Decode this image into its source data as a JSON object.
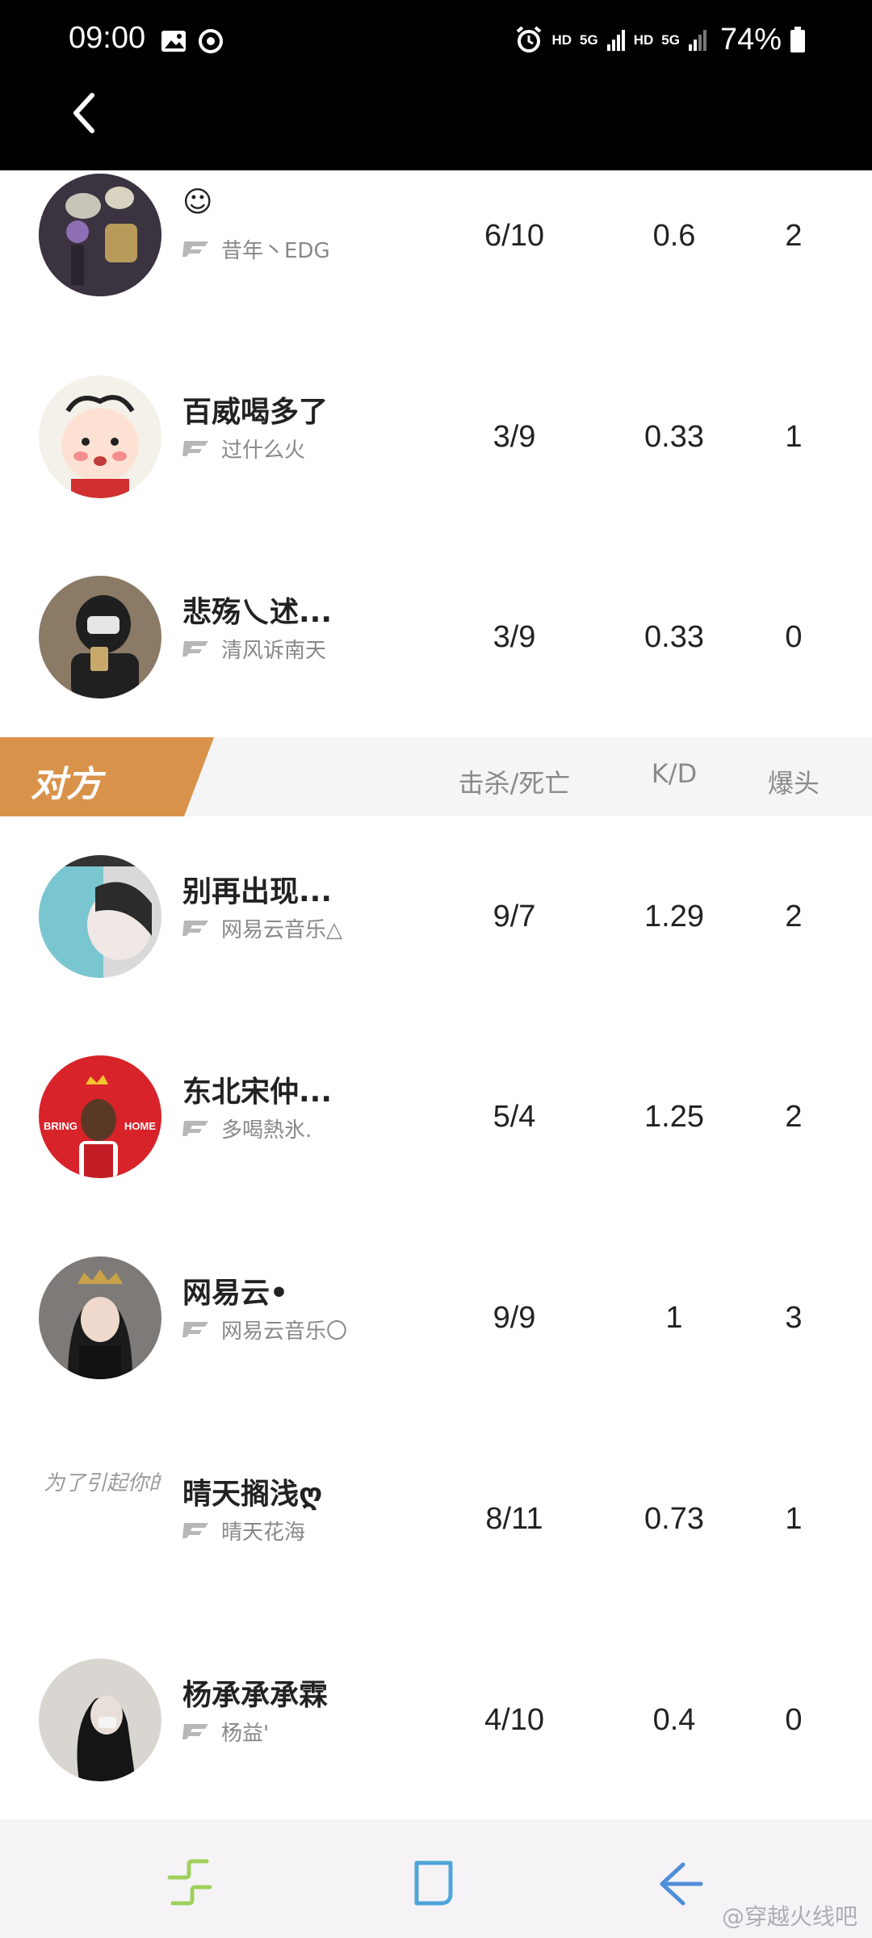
{
  "status_bar": {
    "time": "09:00",
    "hd1": "HD",
    "net1": "5G",
    "hd2": "HD",
    "net2": "5G",
    "battery": "74%"
  },
  "section_opponent": {
    "label": "对方",
    "col_kd": "击杀/死亡",
    "col_ratio": "K/D",
    "col_hs": "爆头",
    "accent_color": "#d9924a"
  },
  "team_players": [
    {
      "name": "☺",
      "sub": "昔年丶EDG",
      "kd": "6/10",
      "ratio": "0.6",
      "hs": "2"
    },
    {
      "name": "百威喝多了",
      "sub": "过什么火",
      "kd": "3/9",
      "ratio": "0.33",
      "hs": "1"
    },
    {
      "name": "悲殇乀述...",
      "sub": "清风诉南天",
      "kd": "3/9",
      "ratio": "0.33",
      "hs": "0"
    }
  ],
  "opponent_players": [
    {
      "name": "别再出现...",
      "sub": "网易云音乐△",
      "kd": "9/7",
      "ratio": "1.29",
      "hs": "2"
    },
    {
      "name": "东北宋仲...",
      "sub": "多喝熱氷.",
      "kd": "5/4",
      "ratio": "1.25",
      "hs": "2",
      "avatar_text_l": "BRING",
      "avatar_text_r": "HOME"
    },
    {
      "name": "网易云•",
      "sub": "网易云音乐〇",
      "kd": "9/9",
      "ratio": "1",
      "hs": "3"
    },
    {
      "name": "晴天搁浅ღ",
      "sub": "晴天花海",
      "kd": "8/11",
      "ratio": "0.73",
      "hs": "1",
      "avatar_text": "为了引起你的注意我真是煞费苦心"
    },
    {
      "name": "杨承承承霖",
      "sub": "杨益'",
      "kd": "4/10",
      "ratio": "0.4",
      "hs": "0"
    }
  ],
  "watermark": "@穿越火线吧"
}
